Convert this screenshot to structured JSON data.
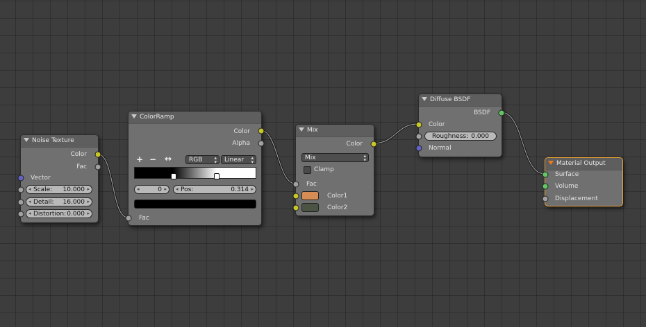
{
  "nodes": {
    "noise": {
      "title": "Noise Texture",
      "outputs": [
        "Color",
        "Fac"
      ],
      "vector_label": "Vector",
      "fields": [
        {
          "label": "Scale:",
          "value": "10.000"
        },
        {
          "label": "Detail:",
          "value": "16.000"
        },
        {
          "label": "Distortion:",
          "value": "0.000"
        }
      ]
    },
    "colorramp": {
      "title": "ColorRamp",
      "outputs": [
        "Color",
        "Alpha"
      ],
      "add_label": "+",
      "remove_label": "−",
      "flip_label": "↔",
      "color_mode": "RGB",
      "interpolation": "Linear",
      "stop_index": "0",
      "pos_label": "Pos:",
      "pos_value": "0.314",
      "fac_label": "Fac",
      "active_color": "#000000"
    },
    "mix": {
      "title": "Mix",
      "output": "Color",
      "blend_type": "Mix",
      "clamp_label": "Clamp",
      "fac_label": "Fac",
      "color1_label": "Color1",
      "color2_label": "Color2",
      "color1": "#d68c55",
      "color2": "#4b5444"
    },
    "diffuse": {
      "title": "Diffuse BSDF",
      "output": "BSDF",
      "color_label": "Color",
      "roughness_label": "Roughness:",
      "roughness_value": "0.000",
      "normal_label": "Normal"
    },
    "output": {
      "title": "Material Output",
      "inputs": [
        "Surface",
        "Volume",
        "Displacement"
      ]
    }
  },
  "colors": {
    "socket_color": "#c7c729",
    "socket_float": "#a1a1a1",
    "socket_vector": "#6363c7",
    "socket_shader": "#63c763",
    "active_border": "#f0a238"
  }
}
